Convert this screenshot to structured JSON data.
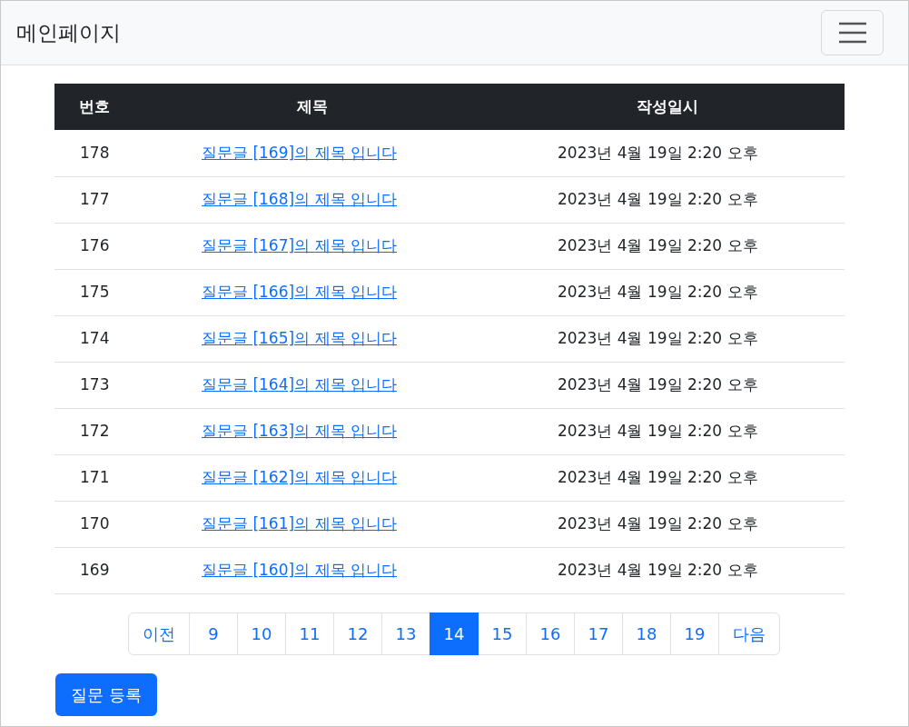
{
  "navbar": {
    "brand": "메인페이지"
  },
  "table": {
    "columns": [
      "번호",
      "제목",
      "작성일시"
    ],
    "rows": [
      {
        "number": "178",
        "title": "질문글 [169]의 제목 입니다",
        "date": "2023년 4월 19일 2:20 오후"
      },
      {
        "number": "177",
        "title": "질문글 [168]의 제목 입니다",
        "date": "2023년 4월 19일 2:20 오후"
      },
      {
        "number": "176",
        "title": "질문글 [167]의 제목 입니다",
        "date": "2023년 4월 19일 2:20 오후"
      },
      {
        "number": "175",
        "title": "질문글 [166]의 제목 입니다",
        "date": "2023년 4월 19일 2:20 오후"
      },
      {
        "number": "174",
        "title": "질문글 [165]의 제목 입니다",
        "date": "2023년 4월 19일 2:20 오후"
      },
      {
        "number": "173",
        "title": "질문글 [164]의 제목 입니다",
        "date": "2023년 4월 19일 2:20 오후"
      },
      {
        "number": "172",
        "title": "질문글 [163]의 제목 입니다",
        "date": "2023년 4월 19일 2:20 오후"
      },
      {
        "number": "171",
        "title": "질문글 [162]의 제목 입니다",
        "date": "2023년 4월 19일 2:20 오후"
      },
      {
        "number": "170",
        "title": "질문글 [161]의 제목 입니다",
        "date": "2023년 4월 19일 2:20 오후"
      },
      {
        "number": "169",
        "title": "질문글 [160]의 제목 입니다",
        "date": "2023년 4월 19일 2:20 오후"
      }
    ]
  },
  "pagination": [
    {
      "label": "이전",
      "selected": false
    },
    {
      "label": "9",
      "selected": false
    },
    {
      "label": "10",
      "selected": false
    },
    {
      "label": "11",
      "selected": false
    },
    {
      "label": "12",
      "selected": false
    },
    {
      "label": "13",
      "selected": false
    },
    {
      "label": "14",
      "selected": true
    },
    {
      "label": "15",
      "selected": false
    },
    {
      "label": "16",
      "selected": false
    },
    {
      "label": "17",
      "selected": false
    },
    {
      "label": "18",
      "selected": false
    },
    {
      "label": "19",
      "selected": false
    },
    {
      "label": "다음",
      "selected": false
    }
  ],
  "register_button": "질문 등록"
}
